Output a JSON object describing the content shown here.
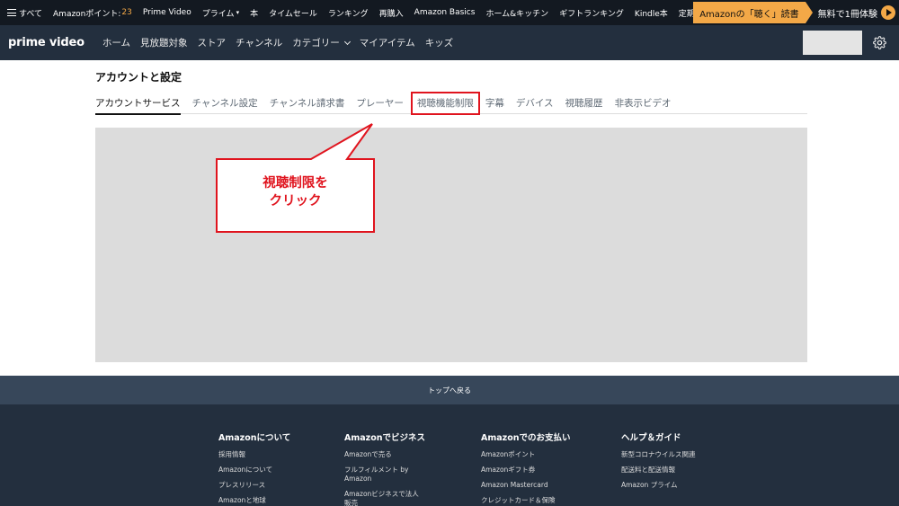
{
  "amazon_nav": {
    "all": "すべて",
    "points_label": "Amazonポイント:",
    "points_value": "23",
    "items": [
      "Prime Video",
      "プライム",
      "本",
      "タイムセール",
      "ランキング",
      "再購入",
      "Amazon Basics",
      "ホーム&キッチン",
      "ギフトランキング",
      "Kindle本",
      "定期おトク便"
    ],
    "promo_left": "Amazonの「聴く」読書",
    "promo_right": "無料で1冊体験"
  },
  "pv_nav": {
    "logo": "prime video",
    "links": [
      "ホーム",
      "見放題対象",
      "ストア",
      "チャンネル",
      "カテゴリー",
      "マイアイテム",
      "キッズ"
    ]
  },
  "settings": {
    "title": "アカウントと設定",
    "tabs": [
      "アカウントサービス",
      "チャンネル設定",
      "チャンネル請求書",
      "プレーヤー",
      "視聴機能制限",
      "字幕",
      "デバイス",
      "視聴履歴",
      "非表示ビデオ"
    ]
  },
  "callout": {
    "line1": "視聴制限を",
    "line2": "クリック"
  },
  "footer": {
    "back_to_top": "トップへ戻る",
    "columns": [
      {
        "heading": "Amazonについて",
        "links": [
          "採用情報",
          "Amazonについて",
          "プレスリリース",
          "Amazonと地球"
        ]
      },
      {
        "heading": "Amazonでビジネス",
        "links": [
          "Amazonで売る",
          "フルフィルメント by Amazon",
          "Amazonビジネスで法人販売"
        ]
      },
      {
        "heading": "Amazonでのお支払い",
        "links": [
          "Amazonポイント",
          "Amazonギフト券",
          "Amazon Mastercard",
          "クレジットカード＆保険"
        ]
      },
      {
        "heading": "ヘルプ＆ガイド",
        "links": [
          "新型コロナウイルス関連",
          "配送料と配送情報",
          "Amazon プライム"
        ]
      }
    ]
  },
  "colors": {
    "amazon_nav_bg": "#131921",
    "pv_nav_bg": "#232f3e",
    "accent_orange": "#f3a847",
    "highlight_red": "#e0141e",
    "back_to_top_bg": "#37475a"
  }
}
